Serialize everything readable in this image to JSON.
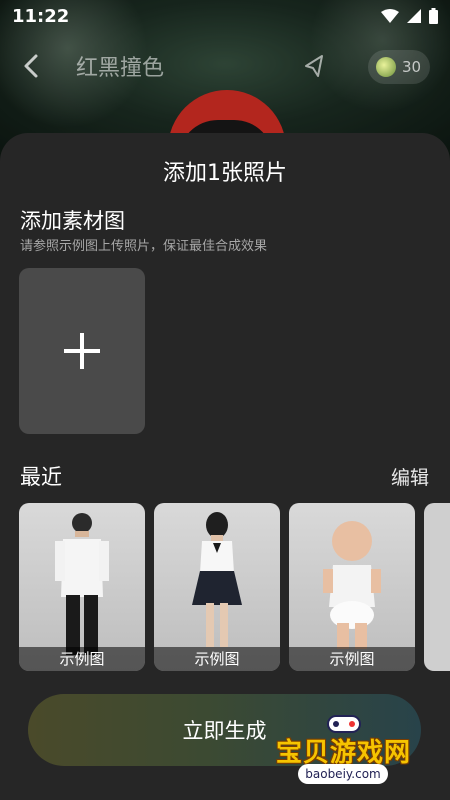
{
  "status": {
    "time": "11:22"
  },
  "header": {
    "title": "红黑撞色",
    "coins": "30"
  },
  "sheet": {
    "title": "添加1张照片",
    "section_title": "添加素材图",
    "section_subtitle": "请参照示例图上传照片，保证最佳合成效果",
    "recent_title": "最近",
    "edit_label": "编辑",
    "thumbs": [
      {
        "label": "示例图"
      },
      {
        "label": "示例图"
      },
      {
        "label": "示例图"
      }
    ],
    "generate_label": "立即生成"
  },
  "watermark": {
    "text": "宝贝游戏网",
    "url": "baobeiy.com"
  },
  "colors": {
    "sheet_bg": "#262626",
    "upload_bg": "#4a4a4a",
    "hat_red": "#b3261e"
  }
}
